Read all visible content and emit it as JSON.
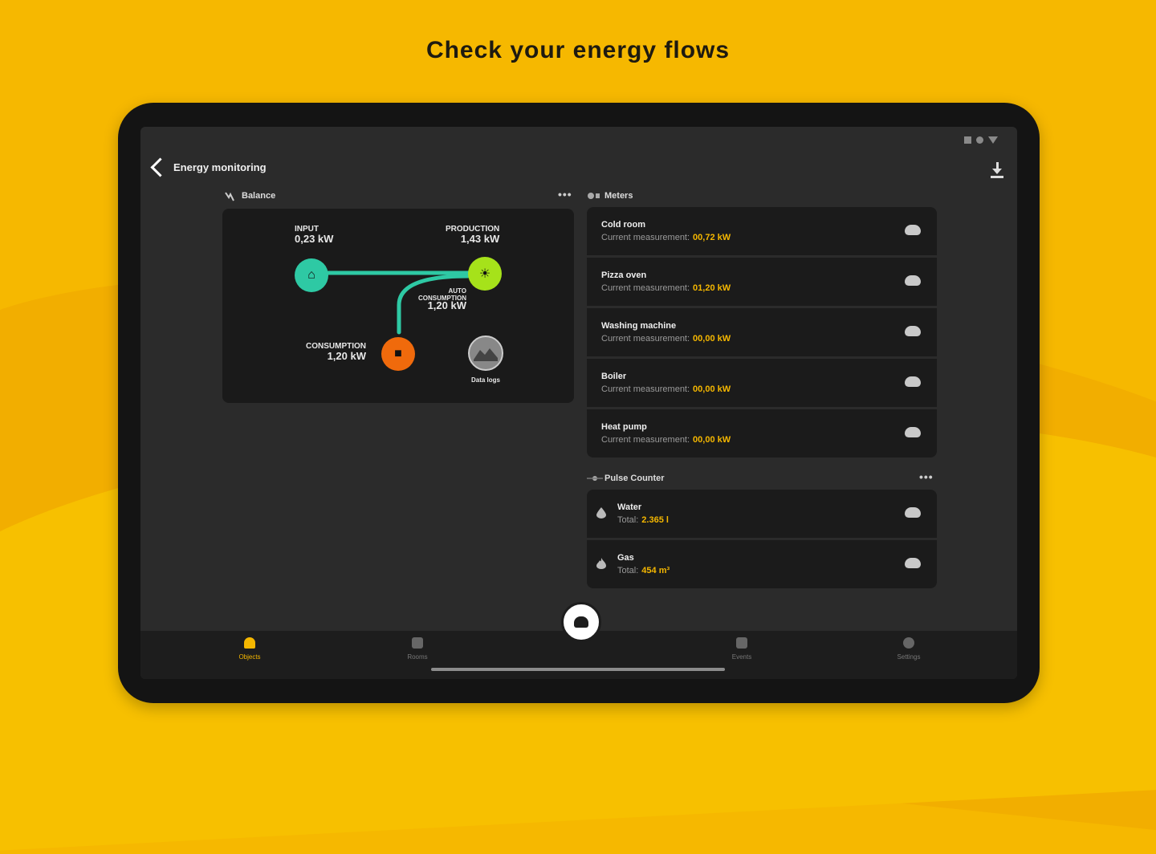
{
  "headline": "Check your energy flows",
  "app_title": "Energy monitoring",
  "balance": {
    "section_title": "Balance",
    "input": {
      "label": "INPUT",
      "value": "0,23 kW"
    },
    "production": {
      "label": "PRODUCTION",
      "value": "1,43 kW"
    },
    "auto": {
      "label1": "AUTO",
      "label2": "CONSUMPTION",
      "value": "1,20 kW"
    },
    "consumption": {
      "label": "CONSUMPTION",
      "value": "1,20 kW"
    },
    "battery_label": "Data logs",
    "colors": {
      "input": "#2ec9a4",
      "production": "#a6e21a",
      "consumption": "#f06a0c"
    }
  },
  "meters": {
    "section_title": "Meters",
    "measure_label": "Current measurement:",
    "items": [
      {
        "name": "Cold room",
        "value": "00,72 kW"
      },
      {
        "name": "Pizza oven",
        "value": "01,20 kW"
      },
      {
        "name": "Washing machine",
        "value": "00,00 kW"
      },
      {
        "name": "Boiler",
        "value": "00,00 kW"
      },
      {
        "name": "Heat pump",
        "value": "00,00 kW"
      }
    ]
  },
  "pulse": {
    "section_title": "Pulse Counter",
    "total_label": "Total:",
    "items": [
      {
        "name": "Water",
        "value": "2.365 l",
        "icon": "drop-icon"
      },
      {
        "name": "Gas",
        "value": "454 m³",
        "icon": "flame-icon"
      }
    ]
  },
  "nav": {
    "objects": "Objects",
    "rooms": "Rooms",
    "events": "Events",
    "settings": "Settings"
  },
  "accent": "#f5b700"
}
